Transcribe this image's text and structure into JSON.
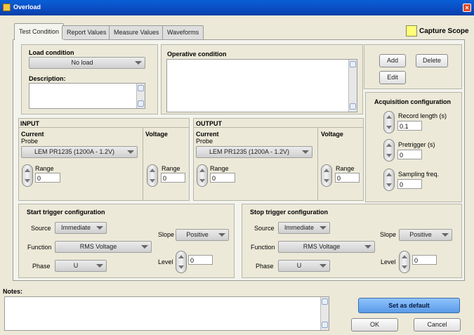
{
  "window": {
    "title": "Overload",
    "close_glyph": "×"
  },
  "tabs": [
    {
      "label": "Test Condition",
      "active": true
    },
    {
      "label": "Report Values"
    },
    {
      "label": "Measure Values"
    },
    {
      "label": "Waveforms"
    }
  ],
  "capture_scope": {
    "label": "Capture Scope",
    "color": "#ffff7a"
  },
  "load_condition": {
    "label": "Load condition",
    "value": "No load",
    "description_label": "Description:"
  },
  "operative_condition": {
    "label": "Operative condition"
  },
  "actions": {
    "add": "Add",
    "delete": "Delete",
    "edit": "Edit"
  },
  "acquisition": {
    "title": "Acquisition configuration",
    "record_length": {
      "label": "Record length (s)",
      "value": "0.1"
    },
    "pretrigger": {
      "label": "Pretrigger (s)",
      "value": "0"
    },
    "sampling": {
      "label": "Sampling freq.",
      "value": "0"
    }
  },
  "input": {
    "title": "INPUT",
    "current": "Current",
    "probe_label": "Probe",
    "probe": "LEM PR1235 (1200A - 1.2V)",
    "range_label": "Range",
    "range_value": "0",
    "voltage": "Voltage",
    "voltage_range_label": "Range",
    "voltage_range_value": "0"
  },
  "output": {
    "title": "OUTPUT",
    "current": "Current",
    "probe_label": "Probe",
    "probe": "LEM PR1235 (1200A - 1.2V)",
    "range_label": "Range",
    "range_value": "0",
    "voltage": "Voltage",
    "voltage_range_label": "Range",
    "voltage_range_value": "0"
  },
  "start_trigger": {
    "title": "Start trigger configuration",
    "source_label": "Source",
    "source": "Immediate",
    "function_label": "Function",
    "function": "RMS Voltage",
    "phase_label": "Phase",
    "phase": "U",
    "slope_label": "Slope",
    "slope": "Positive",
    "level_label": "Level",
    "level": "0"
  },
  "stop_trigger": {
    "title": "Stop trigger configuration",
    "source_label": "Source",
    "source": "Immediate",
    "function_label": "Function",
    "function": "RMS Voltage",
    "phase_label": "Phase",
    "phase": "U",
    "slope_label": "Slope",
    "slope": "Positive",
    "level_label": "Level",
    "level": "0"
  },
  "notes": {
    "label": "Notes:"
  },
  "footer": {
    "set_default": "Set as default",
    "ok": "OK",
    "cancel": "Cancel"
  }
}
